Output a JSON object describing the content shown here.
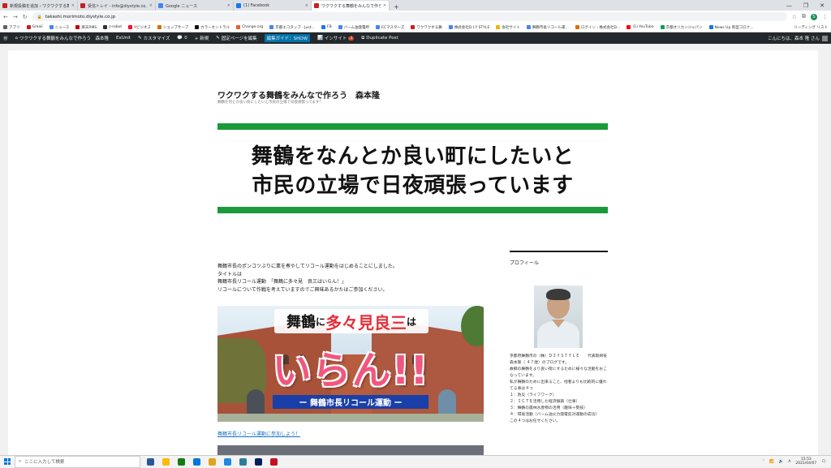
{
  "browser": {
    "tabs": [
      {
        "label": "新規投稿を追加 ‹ ワクワクする舞鶴を…",
        "color": "#c5221f",
        "active": false
      },
      {
        "label": "受信トレイ - info@diystyle.co.jp",
        "color": "#c5221f",
        "active": false
      },
      {
        "label": "Google ニュース",
        "color": "#4285f4",
        "active": false
      },
      {
        "label": "(1) Facebook",
        "color": "#1877f2",
        "active": false
      },
      {
        "label": "ワクワクする舞鶴をみんなで作ろう",
        "color": "#c5221f",
        "active": true
      }
    ],
    "new_tab": "+",
    "close_glyph": "×",
    "window_controls": [
      "—",
      "❐",
      "✕"
    ],
    "url": "takashi.morimoto.diystyle.co.jp",
    "profile_initial": "S",
    "bookmarks": [
      {
        "label": "アプリ",
        "color": "#5f6368"
      },
      {
        "label": "Gmail",
        "color": "#c5221f"
      },
      {
        "label": "ニュース",
        "color": "#4285f4"
      },
      {
        "label": "楽天RMS",
        "color": "#bf0000"
      },
      {
        "label": "z-robot",
        "color": "#333333"
      },
      {
        "label": "Yビジネス",
        "color": "#ff0033"
      },
      {
        "label": "ショップサーブ",
        "color": "#e06b00"
      },
      {
        "label": "カラーセントラル",
        "color": "#111111"
      },
      {
        "label": "Change.org",
        "color": "#eb5a32"
      },
      {
        "label": "京都エコタップ - Just…",
        "color": "#4285f4"
      },
      {
        "label": "FB",
        "color": "#1877f2"
      },
      {
        "label": "バーム油発電所",
        "color": "#4285f4"
      },
      {
        "label": "ECマスターズ",
        "color": "#4285f4"
      },
      {
        "label": "ワクワクする舞",
        "color": "#c5221f"
      },
      {
        "label": "株式会社D.I.Y STYLE",
        "color": "#4285f4"
      },
      {
        "label": "会社サイト",
        "color": "#f4b400"
      },
      {
        "label": "舞鶴市長リコール運…",
        "color": "#4285f4"
      },
      {
        "label": "ログイン ‹ 株式会社D…",
        "color": "#e06b00"
      },
      {
        "label": "(1) YouTube",
        "color": "#ff0000"
      },
      {
        "label": "京都オリカンジャパン",
        "color": "#0f9d58"
      },
      {
        "label": "News Up 新型コロナ…",
        "color": "#1a73e8"
      }
    ],
    "reading_list": "リーディング リスト"
  },
  "wp_admin": {
    "site_name": "ワクワクする舞鶴をみんなで作ろう　森本隆",
    "items": [
      "ExUnit",
      "カスタマイズ",
      "0",
      "+ 新規",
      "固定ページを編集",
      "編集ガイド：SHOW",
      "インサイト",
      "Duplicate Post"
    ],
    "insight_count": "3",
    "howdy": "こんにちは、森本 隆 さん"
  },
  "site": {
    "title": "ワクワクする舞鶴をみんなで作ろう　森本隆",
    "description": "舞鶴を何とか良い街にしたいと市民の立場で日夜頑張ってます！",
    "banner_line1": "舞鶴をなんとか良い町にしたいと",
    "banner_line2": "市民の立場で日夜頑張っています"
  },
  "content": {
    "intro": [
      "舞鶴市長のポンコツぶりに業を煮やしてリコール運動をはじめることにしました。",
      "タイトルは",
      "舞鶴市長リコール運動　「舞鶴に多々見　良三はいらん！」",
      "リコールについて作戦を考えていますのでご興味あるかたはご参加ください。"
    ],
    "hero_text1_a": "舞鶴",
    "hero_text1_b": "に",
    "hero_text1_c": "多々見良三",
    "hero_text1_d": "は",
    "hero_text2": "いらん!!",
    "hero_text3": "ー 舞鶴市長リコール運動 ー",
    "link": "舞鶴市長リコール運動に参加しよう！"
  },
  "sidebar": {
    "heading": "プロフィール",
    "text": [
      "京都府舞鶴市の（株）ＤＩＹＳＴＹＬＥ　　代表取締役　森本隆（ ４７歳）のブログです。",
      "故郷の舞鶴をより良い街にするために様々な活動をおこなっています。",
      "私が舞鶴のために出来ること、他者よりも比較的に優れてる事は４つ",
      "１：防災（ライフワーク）",
      "２：ＩＣＴを活用した経済振興（仕事）",
      "３：舞鶴の農林水産物の活用（趣味＋勢技）",
      "４：環境活動（バーム油火力発電反対運動の成功）",
      "この４つはお任せください。"
    ]
  },
  "taskbar": {
    "search_placeholder": "ここに入力して検索",
    "apps": [
      "#2b5797",
      "#ffb900",
      "#107c10",
      "#0078d7",
      "#e3a21a",
      "#1e88e5",
      "#2d7d9a",
      "#00205b",
      "#c50f1f"
    ],
    "time": "15:53",
    "date": "2021/04/07",
    "ime": "A"
  }
}
